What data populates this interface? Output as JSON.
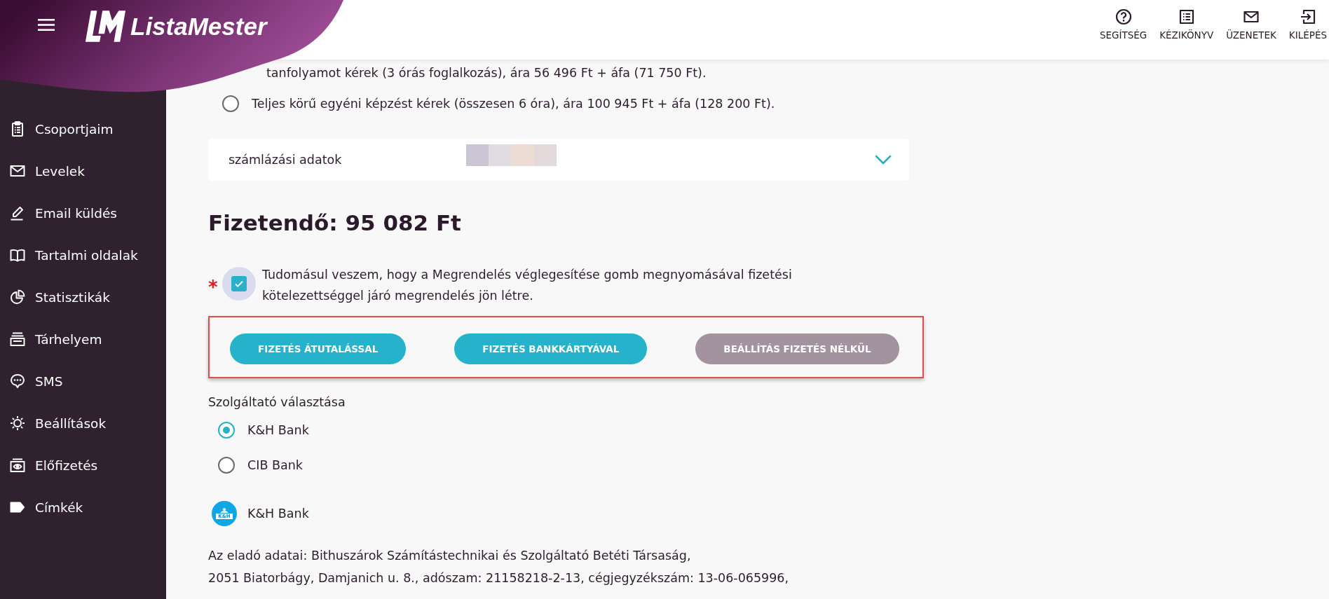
{
  "header": {
    "brand": "ListaMester",
    "actions": [
      {
        "label": "SEGÍTSÉG"
      },
      {
        "label": "KÉZIKÖNYV"
      },
      {
        "label": "ÜZENETEK"
      },
      {
        "label": "KILÉPÉS"
      }
    ]
  },
  "sidebar": {
    "items": [
      {
        "label": "Csoportjaim",
        "selected": false
      },
      {
        "label": "Levelek",
        "selected": false
      },
      {
        "label": "Email küldés",
        "selected": false
      },
      {
        "label": "Tartalmi oldalak",
        "selected": false
      },
      {
        "label": "Statisztikák",
        "selected": false
      },
      {
        "label": "Tárhelyem",
        "selected": false
      },
      {
        "label": "SMS",
        "selected": false
      },
      {
        "label": "Beállítások",
        "selected": false
      },
      {
        "label": "Előfizetés",
        "selected": false
      },
      {
        "label": "Címkék",
        "selected": false
      }
    ]
  },
  "course_options": {
    "cut_off_text": "tanfolyamot kérek (3 órás foglalkozás), ára 56 496 Ft + áfa (71 750 Ft).",
    "options": [
      {
        "label": "Teljes körű egyéni képzést kérek (összesen 6 óra), ára 100 945 Ft + áfa (128 200 Ft).",
        "selected": false
      }
    ]
  },
  "billing": {
    "label": "számlázási adatok",
    "expanded": false
  },
  "total": "Fizetendő: 95 082 Ft",
  "consent": {
    "required_mark": "*",
    "checked": true,
    "text": "Tudomásul veszem, hogy a Megrendelés véglegesítése gomb megnyomásával fizetési kötelezettséggel járó megrendelés jön létre."
  },
  "payment": {
    "highlighted": true,
    "buttons": [
      {
        "label": "FIZETÉS ÁTUTALÁSSAL",
        "disabled": false
      },
      {
        "label": "FIZETÉS BANKKÁRTYÁVAL",
        "disabled": false
      },
      {
        "label": "BEÁLLÍTÁS FIZETÉS NÉLKÜL",
        "disabled": true
      }
    ]
  },
  "provider": {
    "label": "Szolgáltató választása",
    "options": [
      {
        "label": "K&H Bank",
        "selected": true
      },
      {
        "label": "CIB Bank",
        "selected": false
      }
    ]
  },
  "chosen_bank": {
    "logo_text": "K&H",
    "name": "K&H Bank"
  },
  "seller_info": {
    "lines": [
      "Az eladó adatai: Bithuszárok Számítástechnikai és Szolgáltató Betéti Társaság,",
      "2051 Biatorbágy, Damjanich u. 8., adószam: 21158218-2-13, cégjegyzékszám: 13-06-065996,"
    ]
  }
}
